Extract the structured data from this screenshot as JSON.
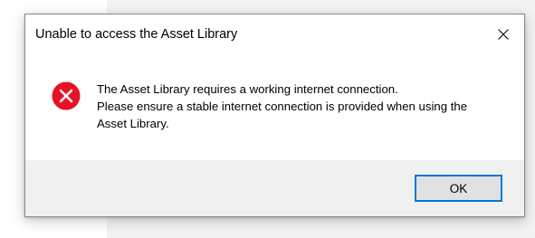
{
  "dialog": {
    "title": "Unable to access the Asset Library",
    "icon": "error-circle-x-icon",
    "message_lines": [
      "The Asset Library requires a working internet connection.",
      "Please ensure a stable internet connection is provided when using the",
      "Asset Library."
    ],
    "ok_label": "OK",
    "colors": {
      "error_red": "#e81123",
      "focus_border": "#0078d7",
      "footer_bg": "#f0f0f0",
      "button_bg": "#e1e1e1"
    }
  }
}
